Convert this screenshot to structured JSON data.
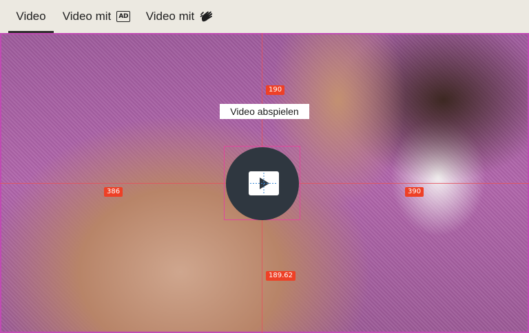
{
  "tabs": [
    {
      "label": "Video",
      "icon": null
    },
    {
      "label": "Video mit",
      "icon": "audio-description-icon",
      "icon_text": "AD"
    },
    {
      "label": "Video mit",
      "icon": "sign-language-icon"
    }
  ],
  "player": {
    "tooltip": "Video abspielen",
    "play_icon": "play-icon"
  },
  "inspector": {
    "top": "190",
    "left": "386",
    "right": "390",
    "bottom": "189.62"
  },
  "colors": {
    "tab_bg": "#ece9e1",
    "highlight_border": "#c04bb3",
    "guide_line": "#e4525c",
    "measure_badge": "#ee4026",
    "play_button": "#2f3740"
  }
}
